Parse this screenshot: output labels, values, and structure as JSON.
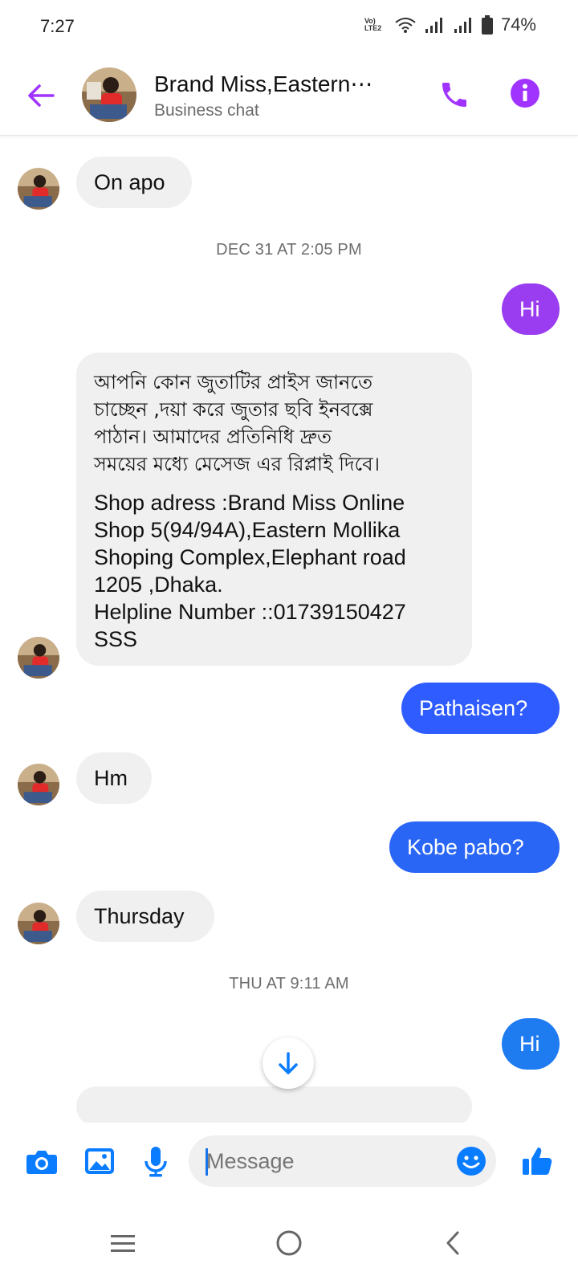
{
  "status": {
    "time": "7:27",
    "network": "Vo) LTE2",
    "battery": "74%"
  },
  "header": {
    "title": "Brand Miss,Eastern⋯",
    "subtitle": "Business chat"
  },
  "colors": {
    "accent_purple": "#a033ff",
    "outgoing_purple": "#9a3cf0",
    "outgoing_blue": "#2f5cff",
    "outgoing_blue2": "#1e7bf0",
    "messenger_blue": "#0a7cff"
  },
  "messages": [
    {
      "from": "them",
      "text": "On apo"
    },
    {
      "timestamp": "DEC 31 AT 2:05 PM"
    },
    {
      "from": "me",
      "text": "Hi"
    },
    {
      "from": "them",
      "lines": [
        "আপনি কোন জুতাটির প্রাইস জানতে",
        "চাচ্ছেন ,দয়া করে জুতার ছবি ইনবক্সে",
        "পাঠান। আমাদের প্রতিনিধি দ্রুত",
        "সময়ের মধ্যে মেসেজ এর রিপ্লাই দিবে।",
        "Shop adress :Brand Miss Online",
        "Shop 5(94/94A),Eastern Mollika",
        "Shoping Complex,Elephant road",
        "1205 ,Dhaka.",
        "Helpline Number ::01739150427",
        "SSS"
      ]
    },
    {
      "from": "me",
      "text": "Pathaisen?"
    },
    {
      "from": "them",
      "text": "Hm"
    },
    {
      "from": "me",
      "text": "Kobe pabo?"
    },
    {
      "from": "them",
      "text": "Thursday"
    },
    {
      "timestamp": "THU AT 9:11 AM"
    },
    {
      "from": "me",
      "text": "Hi"
    }
  ],
  "composer": {
    "placeholder": "Message"
  },
  "icons": {
    "back": "arrow-left-icon",
    "call": "phone-icon",
    "info": "info-icon",
    "camera": "camera-icon",
    "gallery": "image-icon",
    "mic": "microphone-icon",
    "emoji": "emoji-icon",
    "like": "thumbs-up-icon",
    "scroll": "arrow-down-icon"
  }
}
